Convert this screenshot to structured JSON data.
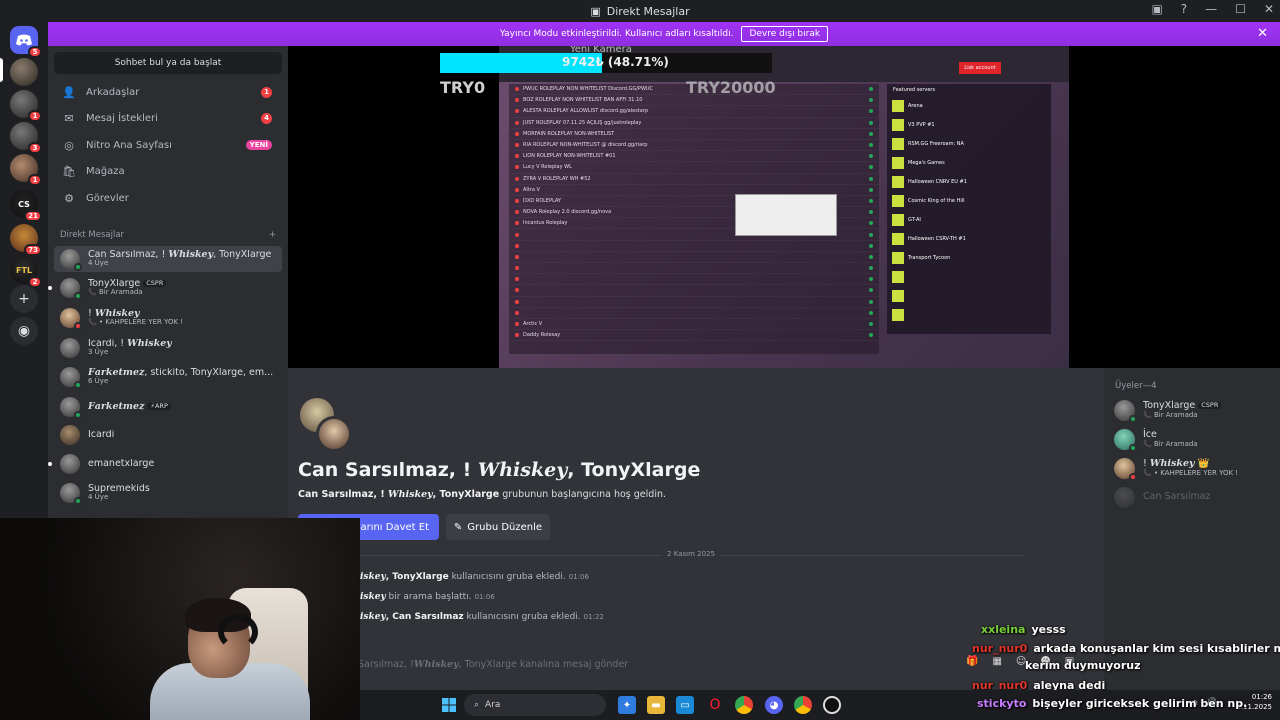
{
  "window": {
    "title": "Direkt Mesajlar",
    "controls": [
      "▣",
      "?",
      "—",
      "☐",
      "✕"
    ]
  },
  "banner": {
    "text": "Yayıncı Modu etkinleştirildi. Kullanıcı adları kısaltıldı.",
    "button": "Devre dışı bırak",
    "close": "✕"
  },
  "rail": {
    "badges": [
      "5",
      "1",
      "3",
      "1",
      "21",
      "73",
      "2"
    ],
    "mono_cs": "CS",
    "mono_ftl": "FTL"
  },
  "sidebar": {
    "search_placeholder": "Sohbet bul ya da başlat",
    "nav": [
      {
        "label": "Arkadaşlar",
        "icon": "friends-icon",
        "count": "1"
      },
      {
        "label": "Mesaj İstekleri",
        "icon": "mail-icon",
        "count": "4"
      },
      {
        "label": "Nitro Ana Sayfası",
        "icon": "nitro-icon",
        "badge": "YENİ"
      },
      {
        "label": "Mağaza",
        "icon": "shop-icon"
      },
      {
        "label": "Görevler",
        "icon": "quests-icon"
      }
    ],
    "dm_header": "Direkt Mesajlar",
    "dm_add": "+",
    "dms": [
      {
        "name_a": "Can Sarsılmaz, ! ",
        "name_i": "𝑾𝒉𝒊𝒔𝒌𝒆𝒚",
        "name_b": ", TonyXlarge",
        "sub": "4 Üye"
      },
      {
        "name_a": "TonyXlarge",
        "tag": "CSPR",
        "sub": "📞 Bir Aramada"
      },
      {
        "name_a": "! ",
        "name_i": "𝑾𝒉𝒊𝒔𝒌𝒆𝒚",
        "sub": "📞 • KAHPELERE YER YOK !"
      },
      {
        "name_a": "Icardi, ! ",
        "name_i": "𝑾𝒉𝒊𝒔𝒌𝒆𝒚",
        "sub": "3 Üye"
      },
      {
        "name_i": "𝑭𝒂𝒓𝒌𝒆𝒕𝒎𝒆𝒛",
        "name_b": ", stickito, TonyXlarge, em...",
        "sub": "6 Üye"
      },
      {
        "name_i": "𝑭𝒂𝒓𝒌𝒆𝒕𝒎𝒆𝒛",
        "tag": "⚡ARP"
      },
      {
        "name_a": "Icardi"
      },
      {
        "name_a": "emanetxlarge"
      },
      {
        "name_a": "Supremekids",
        "sub": "4 Üye"
      }
    ]
  },
  "stream": {
    "camera_label": "Yeni Kamera",
    "progress_text": "9742₺ (48.71%)",
    "progress_fraction": 0.4871,
    "try_left": "TRY0",
    "try_right": "TRY20000",
    "featured_header": "Featured servers",
    "list_rows": [
      "PWUC ROLEPLAY NON WHITELIST Discord.GG/PWUC",
      "BOZ ROLEPLAY NON WHITELIST BAN AFFI 31.10",
      "ALESTA ROLEPLAY ALLOWLIST discord.gg/alestarp",
      "JUST ROLEPLAY 07.11.25 AÇILIŞ gg/justroleplay",
      "MORFAIN ROLEPLAY NON-WHITELIST",
      "RIA ROLEPLAY NON-WHITELIST @ discord.gg/riarp",
      "LION ROLEPLAY NON-WHITELIST #01",
      "Lucy V Roleplay WL",
      "ZYRA V ROLEPLAY WH #52",
      "Altra V",
      "DXD ROLEPLAY",
      "NOVA Roleplay 2.0 discord.gg/nova",
      "Incantus Roleplay",
      "",
      "",
      "",
      "",
      "",
      "",
      "",
      "",
      "Arctic V",
      "Daddy Rolesay"
    ],
    "featured": [
      "Arena",
      "V3 PVP #1",
      "RSM.GG Freeroam: NA",
      "Mega's Games",
      "Halloween CNRV EU #1",
      "Cosmic King of the Hill",
      "GT-AI",
      "Halloween CSRV-TH #1",
      "Transport Tycoon",
      "",
      "",
      ""
    ],
    "red_button": "Lisk account"
  },
  "main": {
    "title_a": "Can Sarsılmaz, ! ",
    "title_i": "𝑾𝒉𝒊𝒔𝒌𝒆𝒚",
    "title_b": ", TonyXlarge",
    "sub_names_a": "Can Sarsılmaz, ! ",
    "sub_names_i": "𝑾𝒉𝒊𝒔𝒌𝒆𝒚",
    "sub_names_b": ", TonyXlarge",
    "sub_rest": " grubunun başlangıcına hoş geldin.",
    "invite_button": "larını Davet Et",
    "edit_button": "Grubu Düzenle",
    "date": "2 Kasım 2025",
    "messages": [
      {
        "who_i": "𝒊𝒔𝒌𝒆𝒚",
        "who_b": ", TonyXlarge",
        "text": " kullanıcısını gruba ekledi.",
        "time": "01:06"
      },
      {
        "who_i": "𝒊𝒔𝒌𝒆𝒚",
        "who_b": "",
        "text": " bir arama başlattı.",
        "time": "01:06"
      },
      {
        "who_i": "𝒊𝒔𝒌𝒆𝒚",
        "who_b": ", Can Sarsılmaz",
        "text": " kullanıcısını gruba ekledi.",
        "time": "01:22"
      }
    ],
    "input_a": "Sarsılmaz, ! ",
    "input_i": "𝑾𝒉𝒊𝒔𝒌𝒆𝒚",
    "input_b": ", TonyXlarge kanalına mesaj gönder"
  },
  "members": {
    "header": "Üyeler—4",
    "list": [
      {
        "name": "TonyXlarge",
        "tag": "CSPR",
        "sub": "📞 Bir Aramada"
      },
      {
        "name": "İce",
        "sub": "📞 Bir Aramada"
      },
      {
        "name_a": "! ",
        "name_i": "𝑾𝒉𝒊𝒔𝒌𝒆𝒚",
        "crown": "👑",
        "sub": "📞 • KAHPELERE YER YOK !"
      },
      {
        "name": "Can Sarsılmaz"
      }
    ]
  },
  "taskbar": {
    "search": "Ara",
    "time": "01:26",
    "date": "2.11.2025"
  },
  "stream_chat": [
    {
      "user": "xxleina",
      "text": "yesss",
      "color": "#7bd13a"
    },
    {
      "user": "nur_nur0",
      "text": "arkada konuşanlar kim sesi kısablirler mi",
      "color": "#e0352b"
    },
    {
      "user": "",
      "text": "kerim duymuyoruz",
      "color": "#ffffff"
    },
    {
      "user": "nur_nur0",
      "text": "aleyna dedi",
      "color": "#e0352b"
    },
    {
      "user": "stickyto",
      "text": "bişeyler giriceksek gelirim ben np.",
      "color": "#c77dff"
    }
  ],
  "colors": {
    "banner": "#9b30ff",
    "blurple": "#5865f2",
    "online": "#23a55a",
    "alert": "#f23f43",
    "progress": "#00e5ff"
  }
}
